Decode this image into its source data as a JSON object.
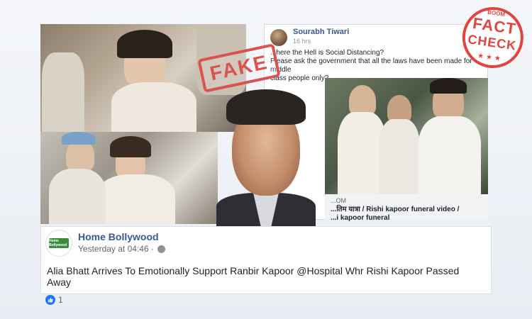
{
  "stamp": {
    "fake_label": "FAKE"
  },
  "top_post": {
    "author": "Sourabh Tiwari",
    "time": "16 hrs",
    "lines": [
      "...here the Hell is Social Distancing?",
      "Please ask the government that all the laws have been made for middle",
      "class people only?"
    ],
    "caption_line1": "...तिम यात्रा / Rishi kapoor funeral video /",
    "caption_line2": "...i kapoor funeral",
    "caption_prefix": "...OM"
  },
  "badge": {
    "brand": "BOOM",
    "word1": "FACT",
    "word2": "CHECK",
    "stars": "★★★"
  },
  "post": {
    "page_name": "Home Bollywood",
    "date": "Yesterday at 04:46",
    "separator": "·",
    "logo_text": "Home Bollywood",
    "text": "Alia Bhatt Arrives To Emotionally Support Ranbir Kapoor @Hospital Whr Rishi Kapoor Passed Away",
    "like_count": "1"
  },
  "icons": {
    "globe": "globe-icon",
    "like": "like-icon",
    "avatar": "avatar"
  },
  "colors": {
    "fb_blue": "#385898",
    "stamp_red": "#d9534f",
    "badge_red": "#e2443f",
    "like_blue": "#2078f4"
  }
}
